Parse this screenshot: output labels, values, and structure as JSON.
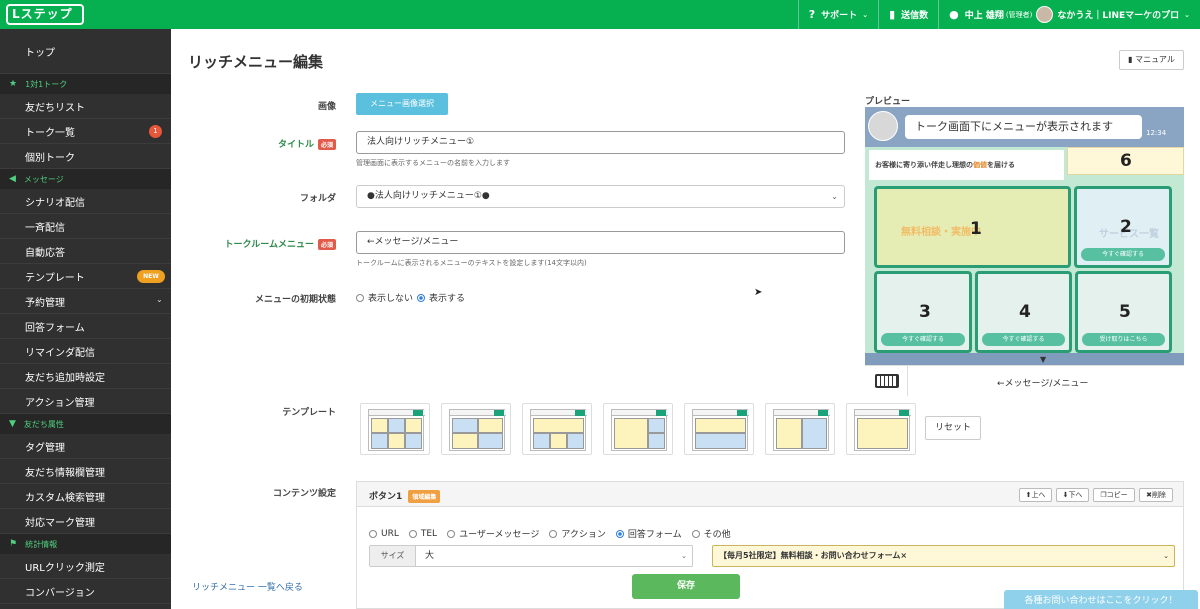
{
  "header": {
    "logo": "Lステップ",
    "support": "サポート",
    "send_count": "送信数",
    "user_name": "中上 雄翔",
    "user_role": "(管理者)",
    "account_name": "なかうえ｜LINEマーケのプロ"
  },
  "sidebar": {
    "top": "トップ",
    "sections": [
      {
        "title": "1対1トーク",
        "items": [
          "友だちリスト",
          "トーク一覧",
          "個別トーク"
        ]
      },
      {
        "title": "メッセージ",
        "items": [
          "シナリオ配信",
          "一斉配信",
          "自動応答",
          "テンプレート",
          "予約管理",
          "回答フォーム",
          "リマインダ配信",
          "友だち追加時設定",
          "アクション管理"
        ]
      },
      {
        "title": "友だち属性",
        "items": [
          "タグ管理",
          "友だち情報欄管理",
          "カスタム検索管理",
          "対応マーク管理"
        ]
      },
      {
        "title": "統計情報",
        "items": [
          "URLクリック測定",
          "コンバージョン"
        ]
      }
    ],
    "talk_badge": "1",
    "new_badge": "NEW"
  },
  "page": {
    "title": "リッチメニュー編集",
    "manual": "マニュアル"
  },
  "form": {
    "image_label": "画像",
    "image_button": "メニュー画像選択",
    "title_label": "タイトル",
    "required": "必須",
    "title_value": "法人向けリッチメニュー①",
    "title_help": "管理画面に表示するメニューの名前を入力します",
    "folder_label": "フォルダ",
    "folder_value": "●法人向けリッチメニュー①●",
    "talkroom_label": "トークルームメニュー",
    "talkroom_value": "←メッセージ/メニュー",
    "talkroom_help": "トークルームに表示されるメニューのテキストを設定します(14文字以内)",
    "initial_label": "メニューの初期状態",
    "initial_options": [
      "表示しない",
      "表示する"
    ],
    "template_label": "テンプレート",
    "reset": "リセット",
    "content_label": "コンテンツ設定"
  },
  "preview": {
    "label": "プレビュー",
    "bubble": "トーク画面下にメニューが表示されます",
    "time": "12:34",
    "menu_header_prefix": "お客様に寄り添い伴走し理想の",
    "menu_header_highlight": "価値",
    "menu_header_suffix": "を届ける",
    "numbers": [
      "1",
      "2",
      "3",
      "4",
      "5",
      "6"
    ],
    "faint_texts": [
      "無料相談・実施中",
      "サービス一覧"
    ],
    "ctas": [
      "今すぐ確認する",
      "今すぐ確認する",
      "今すぐ確認する",
      "受け取りはこちら"
    ],
    "menu_text": "←メッセージ/メニュー"
  },
  "content": {
    "button_title": "ボタン1",
    "area_tag": "領域編集",
    "actions": [
      "上へ",
      "下へ",
      "コピー",
      "削除"
    ],
    "types": [
      "URL",
      "TEL",
      "ユーザーメッセージ",
      "アクション",
      "回答フォーム",
      "その他"
    ],
    "selected_type": "回答フォーム",
    "size_label": "サイズ",
    "size_value": "大",
    "form_value": "【毎月5社限定】無料相談・お問い合わせフォーム×"
  },
  "footer": {
    "back": "リッチメニュー 一覧へ戻る",
    "save": "保存",
    "support": "各種お問い合わせはここをクリック！"
  },
  "colors": {
    "brand": "#06b050",
    "sidebar": "#303030",
    "menu_border": "#2a9d75",
    "save": "#5cb85c"
  }
}
